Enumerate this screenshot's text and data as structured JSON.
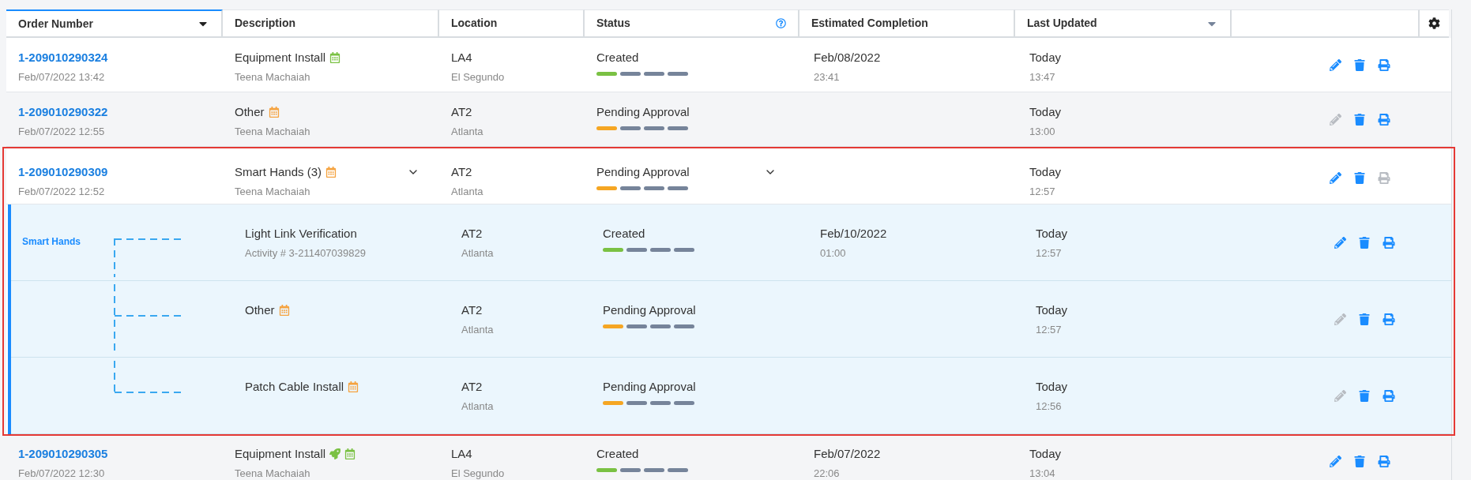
{
  "columns": [
    {
      "label": "Order Number",
      "selected": true,
      "sort_arrow": true,
      "help": false
    },
    {
      "label": "Description",
      "selected": false,
      "sort_arrow": false,
      "help": false
    },
    {
      "label": "Location",
      "selected": false,
      "sort_arrow": false,
      "help": false
    },
    {
      "label": "Status",
      "selected": false,
      "sort_arrow": false,
      "help": true
    },
    {
      "label": "Estimated Completion",
      "selected": false,
      "sort_arrow": false,
      "help": false
    },
    {
      "label": "Last Updated",
      "selected": false,
      "sort_arrow": true,
      "help": false
    }
  ],
  "orders": [
    {
      "order": "1-209010290324",
      "created": "Feb/07/2022 13:42",
      "description": "Equipment Install",
      "icons": [
        {
          "kind": "calendar",
          "color": "#7ac143"
        }
      ],
      "person": "Teena Machaiah",
      "location": "LA4",
      "city": "El Segundo",
      "status": "Created",
      "color": "#7ac143",
      "est_date": "Feb/08/2022",
      "est_time": "23:41",
      "updated": "Today",
      "updated_time": "13:47",
      "edit_enabled": true,
      "print_enabled": true,
      "expanded": false,
      "highlighted": false
    },
    {
      "order": "1-209010290322",
      "created": "Feb/07/2022 12:55",
      "description": "Other",
      "icons": [
        {
          "kind": "calendar",
          "color": "#f5a340"
        }
      ],
      "person": "Teena Machaiah",
      "location": "AT2",
      "city": "Atlanta",
      "status": "Pending Approval",
      "color": "#f5a623",
      "updated": "Today",
      "updated_time": "13:00",
      "edit_enabled": false,
      "print_enabled": true,
      "expanded": false,
      "highlighted": false
    },
    {
      "order": "1-209010290309",
      "created": "Feb/07/2022 12:52",
      "description": "Smart Hands (3)",
      "icons": [
        {
          "kind": "calendar",
          "color": "#f5a340"
        }
      ],
      "person": "Teena Machaiah",
      "location": "AT2",
      "city": "Atlanta",
      "status": "Pending Approval",
      "color": "#f5a623",
      "updated": "Today",
      "updated_time": "12:57",
      "edit_enabled": true,
      "print_enabled": false,
      "expanded": true,
      "highlighted": true,
      "group_label": "Smart Hands",
      "children": [
        {
          "description": "Light Link Verification",
          "sub": "Activity # 3-211407039829",
          "location": "AT2",
          "city": "Atlanta",
          "status": "Created",
          "color": "#7ac143",
          "est_date": "Feb/10/2022",
          "est_time": "01:00",
          "updated": "Today",
          "updated_time": "12:57",
          "edit_enabled": true,
          "print_enabled": true
        },
        {
          "description": "Other",
          "icons": [
            {
              "kind": "calendar",
              "color": "#f5a340"
            }
          ],
          "location": "AT2",
          "city": "Atlanta",
          "status": "Pending Approval",
          "color": "#f5a623",
          "updated": "Today",
          "updated_time": "12:57",
          "edit_enabled": false,
          "print_enabled": true
        },
        {
          "description": "Patch Cable Install",
          "icons": [
            {
              "kind": "calendar",
              "color": "#f5a340"
            }
          ],
          "location": "AT2",
          "city": "Atlanta",
          "status": "Pending Approval",
          "color": "#f5a623",
          "updated": "Today",
          "updated_time": "12:56",
          "edit_enabled": false,
          "print_enabled": true
        }
      ]
    },
    {
      "order": "1-209010290305",
      "created": "Feb/07/2022 12:30",
      "description": "Equipment Install",
      "icons": [
        {
          "kind": "rocket",
          "color": "#7ac143"
        },
        {
          "kind": "calendar",
          "color": "#7ac143"
        }
      ],
      "person": "Teena Machaiah",
      "location": "LA4",
      "city": "El Segundo",
      "status": "Created",
      "color": "#7ac143",
      "est_date": "Feb/07/2022",
      "est_time": "22:06",
      "updated": "Today",
      "updated_time": "13:04",
      "edit_enabled": true,
      "print_enabled": true,
      "expanded": false,
      "highlighted": false
    }
  ]
}
